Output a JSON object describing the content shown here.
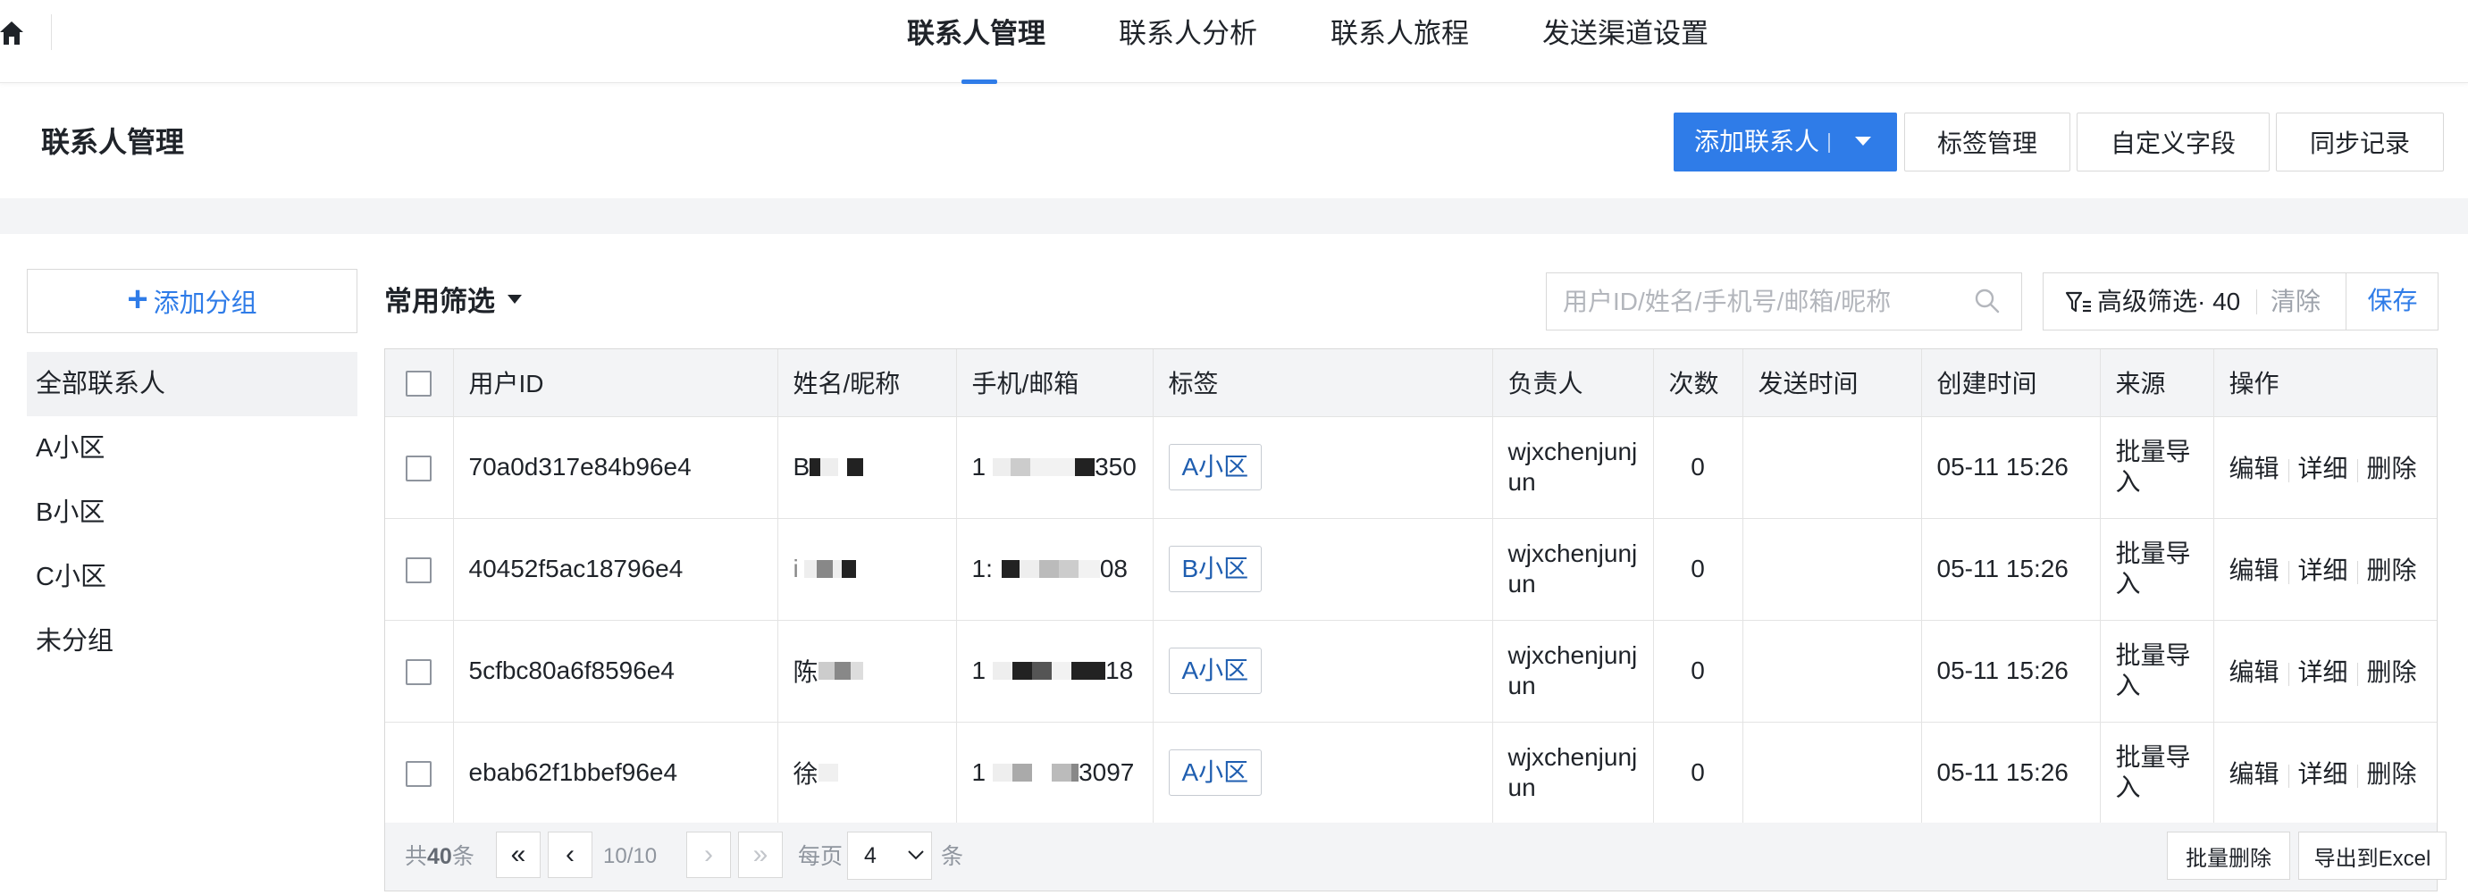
{
  "nav": {
    "tabs": [
      "联系人管理",
      "联系人分析",
      "联系人旅程",
      "发送渠道设置"
    ],
    "active_index": 0
  },
  "header": {
    "title": "联系人管理",
    "add_contact": "添加联系人",
    "tag_manage": "标签管理",
    "custom_fields": "自定义字段",
    "sync_records": "同步记录"
  },
  "sidebar": {
    "add_group": "添加分组",
    "groups": [
      "全部联系人",
      "A小区",
      "B小区",
      "C小区",
      "未分组"
    ],
    "active_index": 0
  },
  "filter": {
    "common": "常用筛选",
    "search_placeholder": "用户ID/姓名/手机号/邮箱/昵称",
    "advanced": "高级筛选· 40",
    "clear": "清除",
    "save": "保存"
  },
  "table": {
    "columns": [
      "用户ID",
      "姓名/昵称",
      "手机/邮箱",
      "标签",
      "负责人",
      "次数",
      "发送时间",
      "创建时间",
      "来源",
      "操作"
    ],
    "rows": [
      {
        "id": "70a0d317e84b96e4",
        "name_prefix": "B",
        "phone_prefix": "1",
        "phone_suffix": "350",
        "tag": "A小区",
        "owner": "wjxchenjunjun",
        "count": "0",
        "send_time": "",
        "created": "05-11 15:26",
        "source": "批量导入"
      },
      {
        "id": "40452f5ac18796e4",
        "name_prefix": "i",
        "phone_prefix": "1:",
        "phone_suffix": "08",
        "tag": "B小区",
        "owner": "wjxchenjunjun",
        "count": "0",
        "send_time": "",
        "created": "05-11 15:26",
        "source": "批量导入"
      },
      {
        "id": "5cfbc80a6f8596e4",
        "name_prefix": "陈",
        "phone_prefix": "1",
        "phone_suffix": "18",
        "tag": "A小区",
        "owner": "wjxchenjunjun",
        "count": "0",
        "send_time": "",
        "created": "05-11 15:26",
        "source": "批量导入"
      },
      {
        "id": "ebab62f1bbef96e4",
        "name_prefix": "徐",
        "phone_prefix": "1",
        "phone_suffix": "3097",
        "tag": "A小区",
        "owner": "wjxchenjunjun",
        "count": "0",
        "send_time": "",
        "created": "05-11 15:26",
        "source": "批量导入"
      }
    ],
    "ops": {
      "edit": "编辑",
      "detail": "详细",
      "delete": "删除"
    }
  },
  "footer": {
    "total_prefix": "共",
    "total": "40",
    "total_suffix": "条",
    "first": "«",
    "prev": "‹",
    "page": "10/10",
    "next": "›",
    "last": "»",
    "per_page_label": "每页",
    "per_page": "4",
    "per_page_unit": "条",
    "bulk_delete": "批量删除",
    "export": "导出到Excel"
  },
  "colors": {
    "accent": "#2f7ce8",
    "header_bg": "#f3f4f6",
    "tag_text": "#1f5eb0"
  }
}
